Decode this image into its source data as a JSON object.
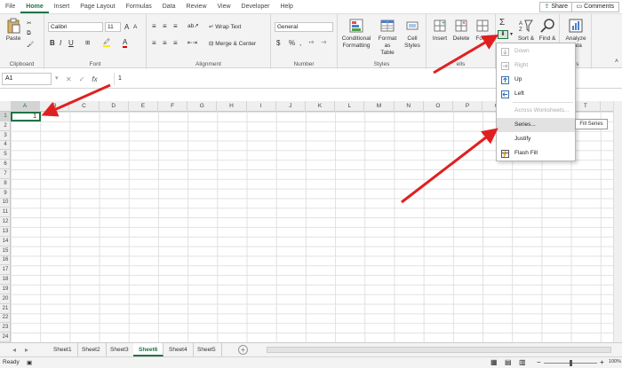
{
  "menu": {
    "tabs": [
      "File",
      "Home",
      "Insert",
      "Page Layout",
      "Formulas",
      "Data",
      "Review",
      "View",
      "Developer",
      "Help"
    ],
    "active": "Home",
    "share": "Share",
    "comments": "Comments"
  },
  "ribbon": {
    "clipboard": {
      "paste": "Paste",
      "label": "Clipboard"
    },
    "font": {
      "name": "Calibri",
      "size": "11",
      "label": "Font",
      "bold": "B",
      "italic": "I",
      "underline": "U"
    },
    "alignment": {
      "wrap": "Wrap Text",
      "merge": "Merge & Center",
      "label": "Alignment"
    },
    "number": {
      "format": "General",
      "currency": "$",
      "percent": "%",
      "comma": ",",
      "label": "Number"
    },
    "styles": {
      "conditional": "Conditional",
      "conditional2": "Formatting",
      "format_as": "Format as",
      "format_as2": "Table",
      "cell": "Cell",
      "cell2": "Styles",
      "label": "Styles"
    },
    "cells": {
      "insert": "Insert",
      "delete": "Delete",
      "format": "Form",
      "label": "ells"
    },
    "editing": {
      "sum": "Σ",
      "sort": "Sort &",
      "find": "Find &",
      "label": ""
    },
    "analyze": {
      "name": "Analyze",
      "name2": "Data",
      "label": "sis"
    }
  },
  "formula_bar": {
    "name_box": "A1",
    "cancel": "✕",
    "enter": "✓",
    "fx": "fx",
    "value": "1"
  },
  "grid": {
    "columns": [
      "A",
      "B",
      "C",
      "D",
      "E",
      "F",
      "G",
      "H",
      "I",
      "J",
      "K",
      "L",
      "M",
      "N",
      "O",
      "P",
      "Q",
      "R",
      "S",
      "T"
    ],
    "rows": [
      "1",
      "2",
      "3",
      "4",
      "5",
      "6",
      "7",
      "8",
      "9",
      "10",
      "11",
      "12",
      "13",
      "14",
      "15",
      "16",
      "17",
      "18",
      "19",
      "20",
      "21",
      "22",
      "23",
      "24"
    ],
    "a1_value": "1"
  },
  "fill_menu": {
    "items": [
      {
        "label": "Down",
        "disabled": true
      },
      {
        "label": "Right",
        "disabled": true
      },
      {
        "label": "Up",
        "disabled": false
      },
      {
        "label": "Left",
        "disabled": false
      },
      {
        "label": "Across Worksheets...",
        "disabled": true
      },
      {
        "label": "Series...",
        "disabled": false
      },
      {
        "label": "Justify",
        "disabled": false
      },
      {
        "label": "Flash Fill",
        "disabled": false
      }
    ],
    "tooltip": "Fill Series"
  },
  "sheets": {
    "tabs": [
      "Sheet1",
      "Sheet2",
      "Sheet3",
      "Sheet6",
      "Sheet4",
      "Sheet5"
    ],
    "active": "Sheet6",
    "add": "+"
  },
  "status": {
    "mode": "Ready",
    "zoom": "100%"
  },
  "colors": {
    "accent": "#217346",
    "arrow": "#e02020"
  }
}
